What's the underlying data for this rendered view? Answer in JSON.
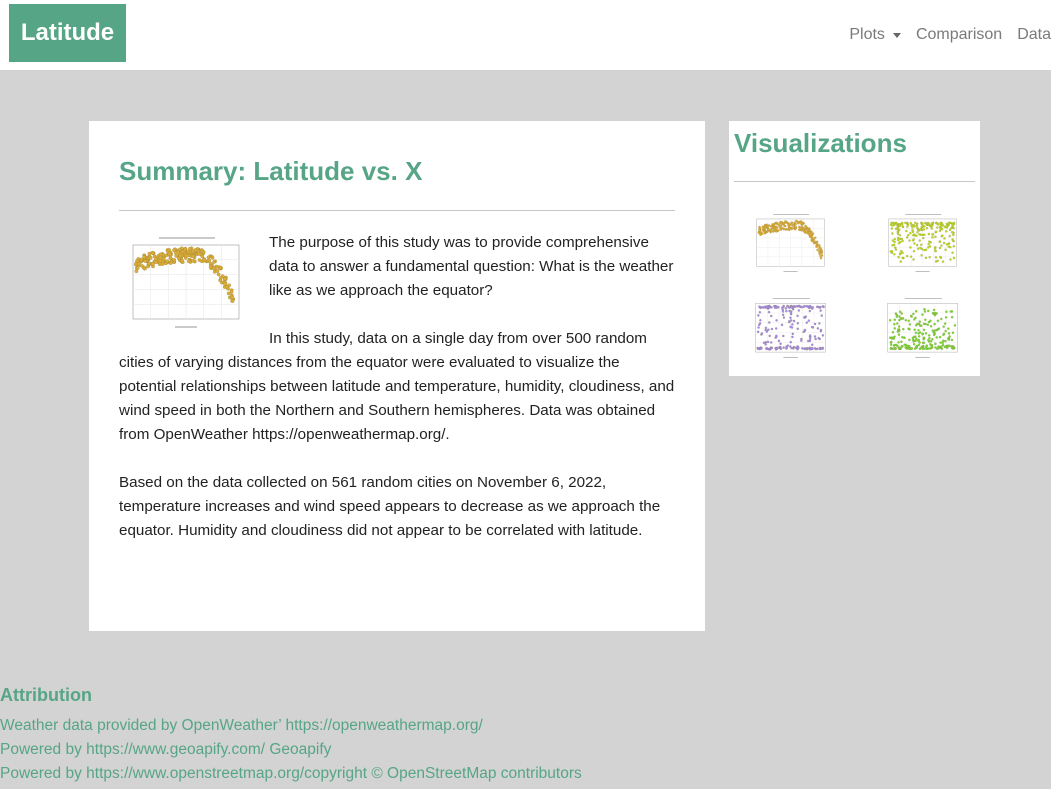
{
  "navbar": {
    "brand": "Latitude",
    "links": [
      {
        "label": "Plots"
      },
      {
        "label": "Comparison"
      },
      {
        "label": "Data"
      }
    ]
  },
  "main": {
    "title": "Summary: Latitude vs. X",
    "p1": "The purpose of this study was to provide comprehensive data to answer a fundamental question: What is the weather like as we approach the equator?",
    "p2": "In this study, data on a single day from over 500 random cities of varying distances from the equator were evaluated to visualize the potential relationships between latitude and temperature, humidity, cloudiness, and wind speed in both the Northern and Southern hemispheres. Data was obtained from OpenWeather https://openweathermap.org/.",
    "p3": "Based on the data collected on 561 random cities on November 6, 2022, temperature increases and wind speed appears to decrease as we approach the equator. Humidity and cloudiness did not appear to be correlated with latitude."
  },
  "sidebar": {
    "title": "Visualizations",
    "thumbs": [
      {
        "color": "#daa520",
        "pattern": "arch"
      },
      {
        "color": "#b5d40e",
        "pattern": "high"
      },
      {
        "color": "#9b7fe8",
        "pattern": "bands"
      },
      {
        "color": "#6ad31f",
        "pattern": "low"
      }
    ]
  },
  "attribution": {
    "title": "Attribution",
    "lines": [
      "Weather data provided by OpenWeather’ https://openweathermap.org/",
      "Powered by https://www.geoapify.com/ Geoapify",
      "Powered by https://www.openstreetmap.org/copyright © OpenStreetMap contributors"
    ]
  },
  "colors": {
    "accent": "#56a586",
    "background": "#d3d3d3"
  }
}
